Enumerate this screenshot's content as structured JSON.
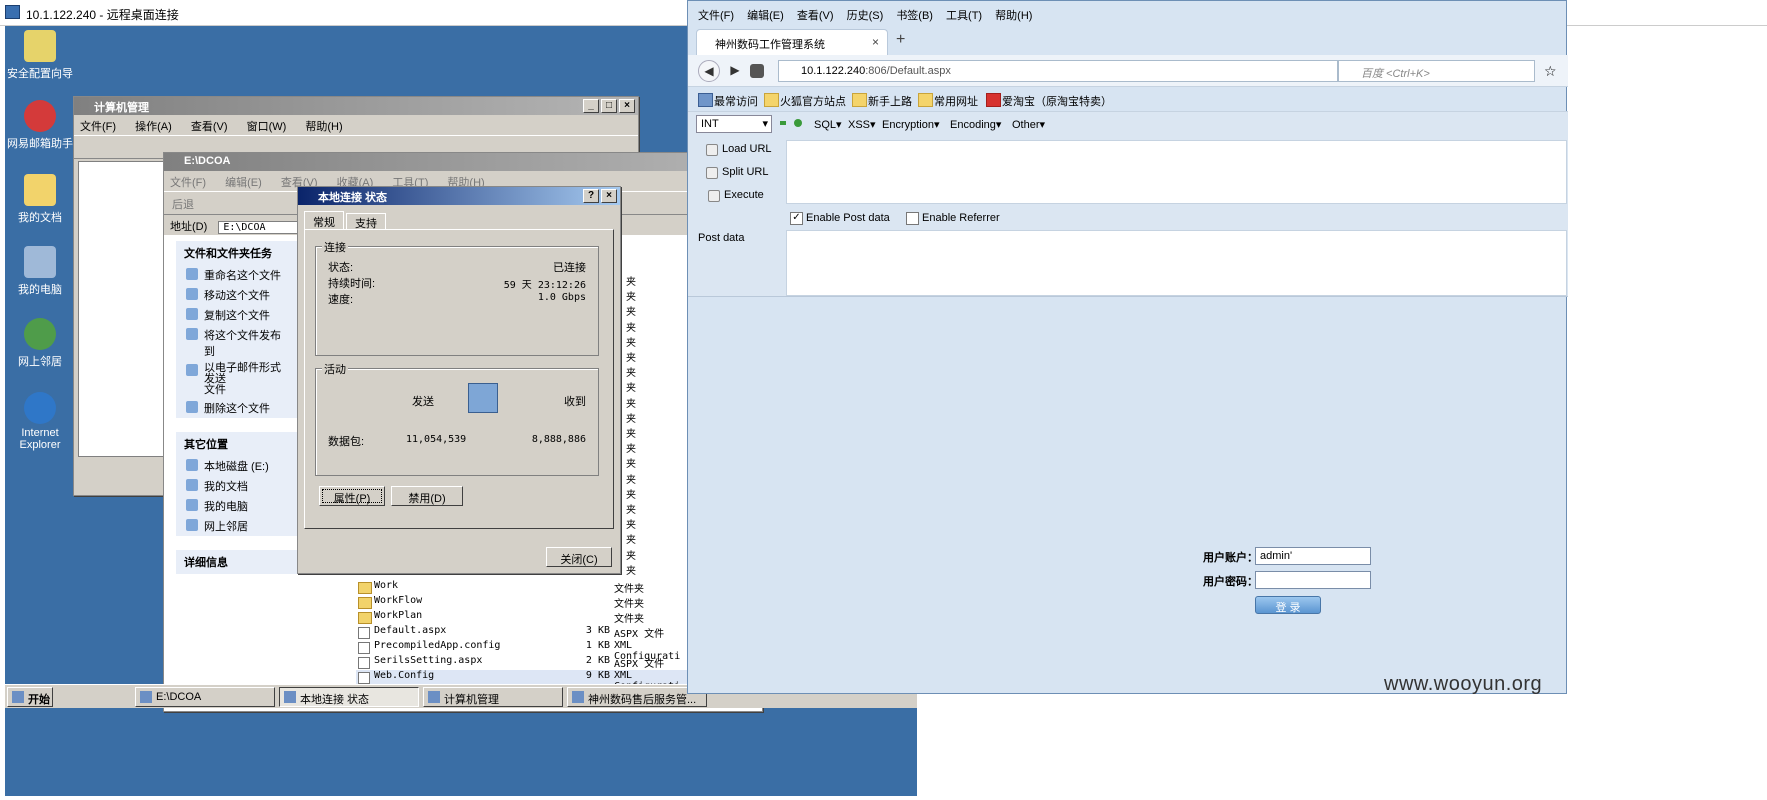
{
  "rdp": {
    "title": "10.1.122.240 - 远程桌面连接"
  },
  "desktop": {
    "icons": [
      "安全配置向导",
      "网易邮箱助手",
      "我的文档",
      "我的电脑",
      "网上邻居",
      "Internet Explorer"
    ]
  },
  "compmgmt": {
    "title": "计算机管理",
    "menu": [
      "文件(F)",
      "操作(A)",
      "查看(V)",
      "窗口(W)",
      "帮助(H)"
    ]
  },
  "explorer": {
    "title": "E:\\DCOA",
    "menu": [
      "文件(F)",
      "编辑(E)",
      "查看(V)",
      "收藏(A)",
      "工具(T)",
      "帮助(H)"
    ],
    "back": "后退",
    "address_label": "地址(D)",
    "address": "E:\\DCOA",
    "tasks_header": "文件和文件夹任务",
    "tasks": [
      "重命名这个文件",
      "移动这个文件",
      "复制这个文件",
      "将这个文件发布到",
      "以电子邮件形式发送",
      "文件",
      "删除这个文件"
    ],
    "places_header": "其它位置",
    "places": [
      "本地磁盘 (E:)",
      "我的文档",
      "我的电脑",
      "网上邻居"
    ],
    "details_header": "详细信息",
    "type_col_fragment": "夹",
    "files": [
      {
        "name": "Work",
        "size": "",
        "type": "文件夹"
      },
      {
        "name": "WorkFlow",
        "size": "",
        "type": "文件夹"
      },
      {
        "name": "WorkPlan",
        "size": "",
        "type": "文件夹"
      },
      {
        "name": "Default.aspx",
        "size": "3 KB",
        "type": "ASPX 文件"
      },
      {
        "name": "PrecompiledApp.config",
        "size": "1 KB",
        "type": "XML Configurati"
      },
      {
        "name": "SerilsSetting.aspx",
        "size": "2 KB",
        "type": "ASPX 文件"
      },
      {
        "name": "Web.Config",
        "size": "9 KB",
        "type": "XML Configurati"
      }
    ]
  },
  "lanstatus": {
    "title": "本地连接 状态",
    "tabs": [
      "常规",
      "支持"
    ],
    "conn_group": "连接",
    "status_label": "状态:",
    "status_value": "已连接",
    "duration_label": "持续时间:",
    "duration_value": "59 天 23:12:26",
    "speed_label": "速度:",
    "speed_value": "1.0 Gbps",
    "activity_group": "活动",
    "sent_label": "发送",
    "recv_label": "收到",
    "packets_label": "数据包:",
    "packets_sent": "11,054,539",
    "packets_recv": "8,888,886",
    "properties_btn": "属性(P)",
    "disable_btn": "禁用(D)",
    "close_btn": "关闭(C)"
  },
  "taskbar": {
    "start": "开始",
    "items": [
      "E:\\DCOA",
      "本地连接 状态",
      "计算机管理",
      "神州数码售后服务管..."
    ]
  },
  "firefox": {
    "menu": [
      "文件(F)",
      "编辑(E)",
      "查看(V)",
      "历史(S)",
      "书签(B)",
      "工具(T)",
      "帮助(H)"
    ],
    "tab_title": "神州数码工作管理系统",
    "tab_close": "×",
    "new_tab": "+",
    "url_domain": "10.1.122.240",
    "url_path": ":806/Default.aspx",
    "search_placeholder": "百度 <Ctrl+K>",
    "bookmarks": [
      "最常访问",
      "火狐官方站点",
      "新手上路",
      "常用网址",
      "爱淘宝（原淘宝特卖）"
    ]
  },
  "hackbar": {
    "select": "INT",
    "menus": [
      "SQL▾",
      "XSS▾",
      "Encryption▾",
      "Encoding▾",
      "Other▾"
    ],
    "load_url": "Load URL",
    "split_url": "Split URL",
    "execute": "Execute",
    "enable_post": "Enable Post data",
    "enable_referrer": "Enable Referrer",
    "post_label": "Post data"
  },
  "login": {
    "user_label": "用户账户：",
    "user_value": "admin'",
    "pass_label": "用户密码：",
    "button": "登 录"
  },
  "watermark": "www.wooyun.org",
  "colors": {
    "desktop": "#3a6ea5",
    "title_active": "#0a246a",
    "firefox_bg": "#d7e4f2"
  }
}
